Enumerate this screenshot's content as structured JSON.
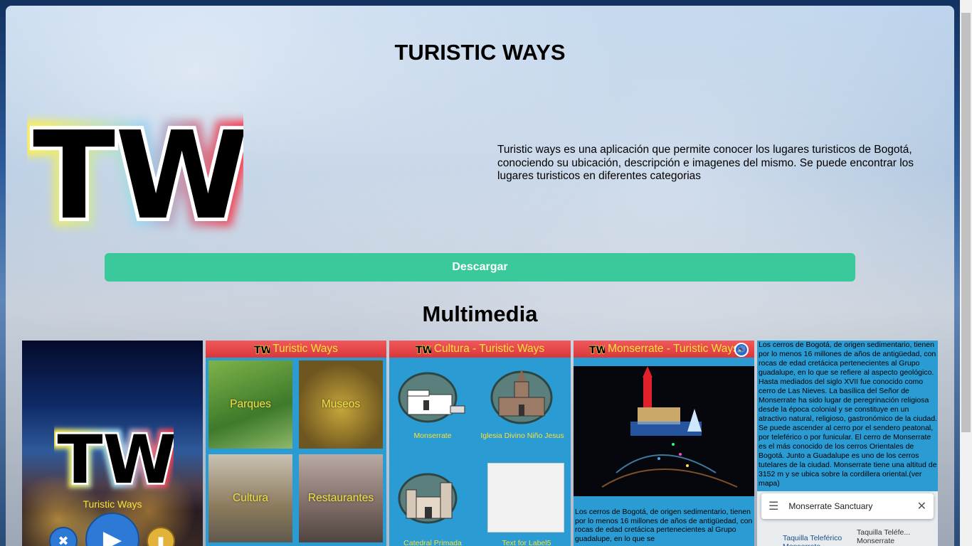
{
  "header": {
    "title": "TURISTIC WAYS"
  },
  "logo": {
    "text": "TW"
  },
  "description": "Turistic ways es una aplicación que permite conocer los lugares turisticos de Bogotá, conociendo su ubicación, descripción e imagenes del mismo. Se puede encontrar los lugares turisticos en diferentes categorias",
  "download": {
    "label": "Descargar"
  },
  "multimedia": {
    "title": "Multimedia",
    "shot1": {
      "label": "Turistic Ways"
    },
    "shot2": {
      "bar": "Turistic Ways",
      "tiles": [
        "Parques",
        "Museos",
        "Cultura",
        "Restaurantes"
      ]
    },
    "shot3": {
      "bar": "Cultura - Turistic Ways",
      "places": [
        "Monserrate",
        "Iglesia Divino Niño Jesus",
        "Catedral Primada",
        "Text for Label5"
      ]
    },
    "shot4": {
      "bar": "Monserrate - Turistic Ways",
      "text": "Los cerros de Bogotá, de origen sedimentario, tienen por lo menos 16 millones de años de antigüedad, con rocas de edad cretácica pertenecientes al Grupo guadalupe, en lo que se"
    },
    "shot5": {
      "text": "Los cerros de Bogotá, de origen sedimentario, tienen por lo menos 16 millones de años de antigüedad, con rocas de edad cretácica pertenecientes al Grupo guadalupe, en lo que se refiere al aspecto geológico. Hasta mediados del siglo XVII fue conocido como cerro de Las Nieves. La basílica del Señor de Monserrate ha sido lugar de peregrinación religiosa desde la época colonial y se constituye en un atractivo natural, religioso, gastronómico de la ciudad. Se puede ascender al cerro por el sendero peatonal, por teleférico o por funicular. El cerro de Monserrate es el más conocido de los cerros Orientales de Bogotá. Junto a Guadalupe es uno de los cerros tutelares de la ciudad. Monserrate tiene una altitud de 3152 m y se ubica sobre la cordillera oriental.(ver mapa)",
      "search": "Monserrate Sanctuary",
      "map_label_1": "Taquilla Teleférico Monserrate",
      "map_label_2": "Taquilla Teléfe... Monserrate"
    }
  }
}
